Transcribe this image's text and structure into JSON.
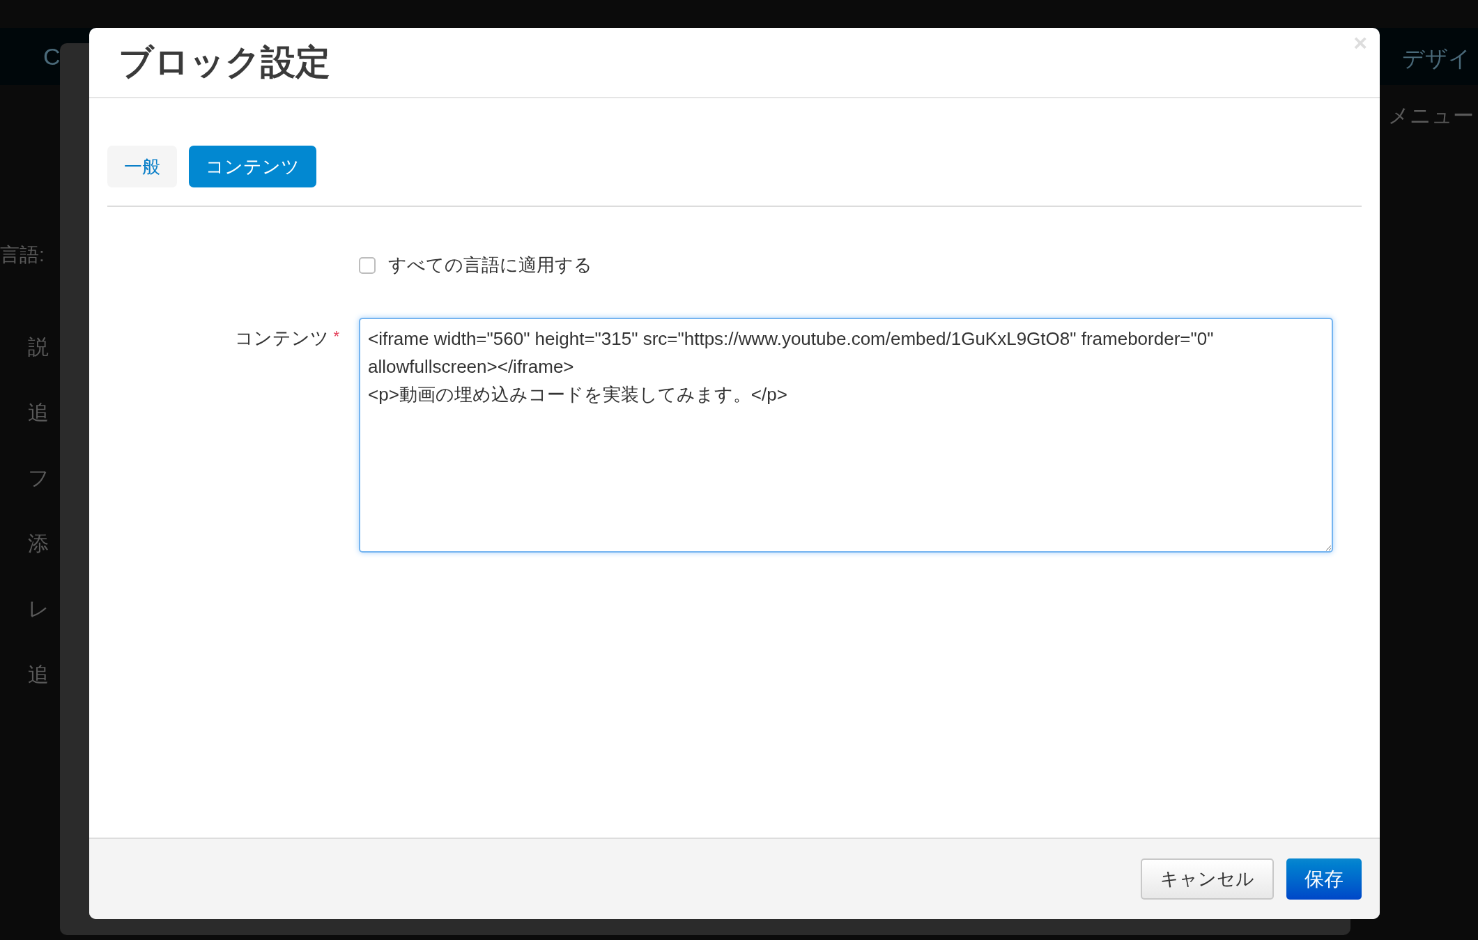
{
  "background": {
    "header_text": "C",
    "top_right_text": "デザイ",
    "menu_text": "メニュー",
    "side_texts": [
      "言語:",
      "説",
      "追",
      "フ",
      "添",
      "レ",
      "追"
    ]
  },
  "dialog": {
    "title": "ブロック設定",
    "close": "×",
    "tabs": [
      {
        "label": "一般",
        "selected": false
      },
      {
        "label": "コンテンツ",
        "selected": true
      }
    ],
    "apply_all": {
      "label": "すべての言語に適用する",
      "checked": false
    },
    "content_field": {
      "label": "コンテンツ",
      "required": true,
      "required_mark": "*",
      "value": "<iframe width=\"560\" height=\"315\" src=\"https://www.youtube.com/embed/1GuKxL9GtO8\" frameborder=\"0\" allowfullscreen></iframe>\n<p>動画の埋め込みコードを実装してみます。</p>"
    },
    "buttons": [
      {
        "label": "キャンセル",
        "kind": "secondary"
      },
      {
        "label": "保存",
        "kind": "primary"
      }
    ]
  }
}
